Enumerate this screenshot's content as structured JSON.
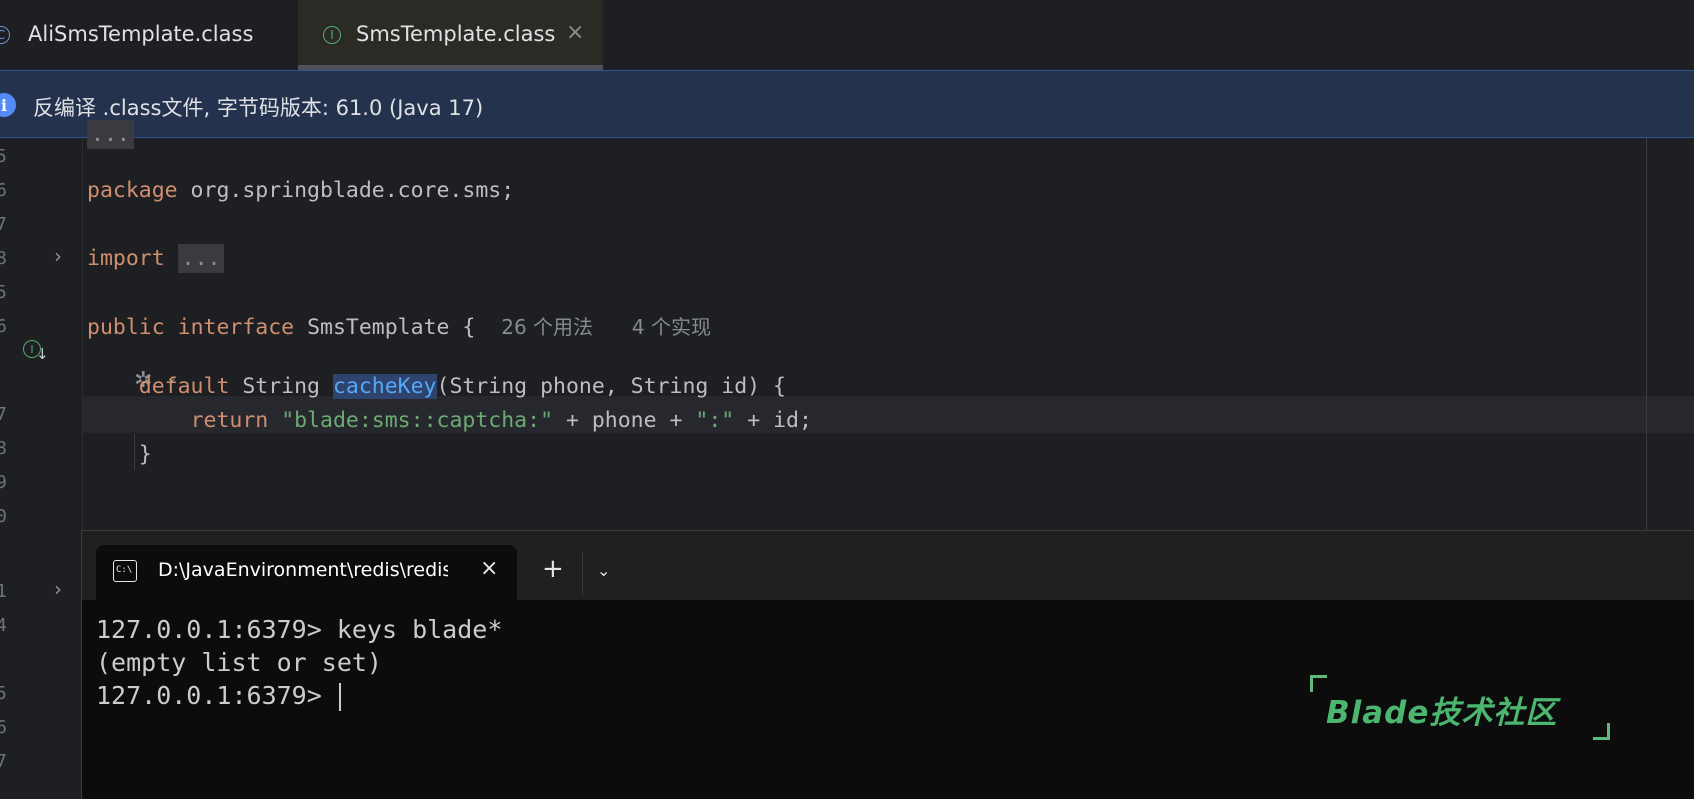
{
  "tabs": [
    {
      "icon": "class-icon",
      "glyph": "C",
      "label": "AliSmsTemplate.class"
    },
    {
      "icon": "interface-icon",
      "glyph": "I",
      "label": "SmsTemplate.class",
      "close": "×"
    }
  ],
  "banner": {
    "icon": "info-icon",
    "glyph": "i",
    "text": "反编译 .class文件, 字节码版本: 61.0 (Java 17)"
  },
  "editor": {
    "line_numbers": [
      "5",
      "6",
      "7",
      "8",
      "5",
      "6",
      "7",
      "8",
      "9",
      "0",
      "1",
      "4",
      "5",
      "6",
      "7"
    ],
    "fold_arrow": "›",
    "lines": {
      "package_kw": "package",
      "package_name": " org.springblade.core.sms;",
      "import_kw": "import",
      "import_folded": "...",
      "public_kw": "public",
      "interface_kw": "interface",
      "interface_name": " SmsTemplate {",
      "usages_hint": "26 个用法",
      "impl_hint": "4 个实现",
      "default_kw": "default",
      "return_type": " String ",
      "method_name": "cacheKey",
      "method_params": "(String phone, String id) {",
      "return_kw": "return",
      "return_str1": "\"blade:sms::captcha:\"",
      "return_mid": " + phone + ",
      "return_str2": "\":\"",
      "return_tail": " + id;",
      "close_brace": "}"
    }
  },
  "terminal": {
    "tab_icon": "terminal-icon",
    "tab_icon_text": "C:\\",
    "tab_title": "D:\\JavaEnvironment\\redis\\redis-cli.exe",
    "tab_close": "×",
    "add_tab": "+",
    "dropdown": "⌄",
    "lines": [
      "127.0.0.1:6379> keys blade*",
      "(empty list or set)",
      "127.0.0.1:6379> "
    ]
  },
  "watermark": {
    "text": "Blade技术社区",
    "color": "#4cb56f"
  }
}
